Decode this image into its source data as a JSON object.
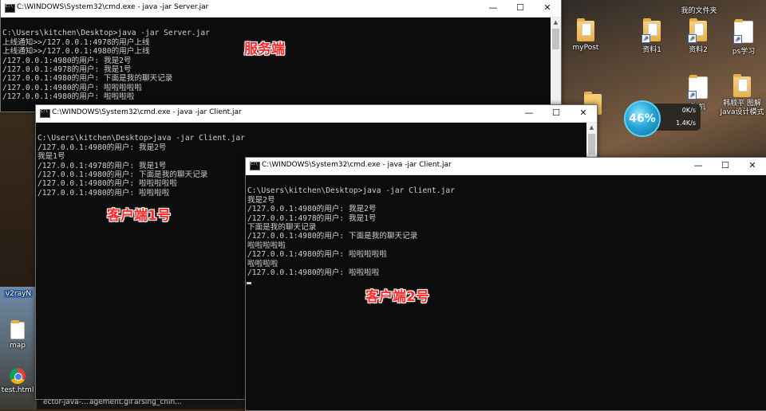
{
  "desktop": {
    "right_icons": [
      {
        "label": "我的文件夹",
        "icon": "folder-icon"
      },
      {
        "label": "myPost",
        "icon": "document-icon"
      },
      {
        "label": "资料1",
        "icon": "folder-icon"
      },
      {
        "label": "资料2",
        "icon": "folder-icon"
      },
      {
        "label": "ps学习",
        "icon": "document-icon"
      },
      {
        "label": "联机",
        "icon": "document-icon"
      },
      {
        "label": "韩顺平 图解Java设计模式",
        "icon": "folder-icon"
      }
    ],
    "left_icons": [
      {
        "label": "v2rayN",
        "icon": "app-icon"
      },
      {
        "label": "map",
        "icon": "file-icon"
      },
      {
        "label": "test.html",
        "icon": "chrome-icon"
      }
    ],
    "speed_widget": {
      "percent": "46%",
      "upload": "0K/s",
      "download": "1.4K/s"
    },
    "taskbar_items": [
      "ector-java-...",
      "agement.gif",
      "arsing_chin..."
    ]
  },
  "windows": {
    "server": {
      "title": "C:\\WINDOWS\\System32\\cmd.exe - java  -jar Server.jar",
      "lines": [
        "",
        "C:\\Users\\kitchen\\Desktop>java -jar Server.jar",
        "上线通知>>/127.0.0.1:4978的用户上线",
        "上线通知>>/127.0.0.1:4980的用户上线",
        "/127.0.0.1:4980的用户: 我是2号",
        "/127.0.0.1:4978的用户: 我是1号",
        "/127.0.0.1:4980的用户: 下面是我的聊天记录",
        "/127.0.0.1:4980的用户: 啦啦啦啦啦",
        "/127.0.0.1:4980的用户: 啦啦啦啦"
      ],
      "label": "服务端"
    },
    "client1": {
      "title": "C:\\WINDOWS\\System32\\cmd.exe - java  -jar Client.jar",
      "lines": [
        "",
        "C:\\Users\\kitchen\\Desktop>java -jar Client.jar",
        "/127.0.0.1:4980的用户: 我是2号",
        "我是1号",
        "/127.0.0.1:4978的用户: 我是1号",
        "/127.0.0.1:4980的用户: 下面是我的聊天记录",
        "/127.0.0.1:4980的用户: 啦啦啦啦啦",
        "/127.0.0.1:4980的用户: 啦啦啦啦"
      ],
      "label": "客户端1号"
    },
    "client2": {
      "title": "C:\\WINDOWS\\System32\\cmd.exe - java  -jar Client.jar",
      "lines": [
        "",
        "C:\\Users\\kitchen\\Desktop>java -jar Client.jar",
        "我是2号",
        "/127.0.0.1:4980的用户: 我是2号",
        "/127.0.0.1:4978的用户: 我是1号",
        "下面是我的聊天记录",
        "/127.0.0.1:4980的用户: 下面是我的聊天记录",
        "啦啦啦啦啦",
        "/127.0.0.1:4980的用户: 啦啦啦啦啦",
        "啦啦啦啦",
        "/127.0.0.1:4980的用户: 啦啦啦啦"
      ],
      "label": "客户端2号"
    }
  },
  "controls": {
    "minimize": "—",
    "maximize": "☐",
    "close": "✕"
  }
}
